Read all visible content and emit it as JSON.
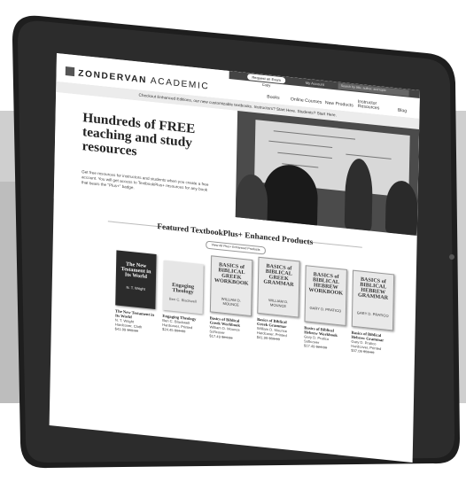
{
  "topbar": {
    "exam_pill": "Request an Exam Copy",
    "account": "My Account",
    "search_placeholder": "Search by title, author, and topic"
  },
  "brand": {
    "logo_bold": "ZONDERVAN",
    "logo_light": "ACADEMIC"
  },
  "nav": {
    "items": [
      "Books",
      "Online Courses",
      "New Products",
      "Instructor Resources",
      "Blog"
    ]
  },
  "banner": {
    "text": "Checkout Enhanced Editions, our new customizable textbooks. Instructors? Start Here. Students? Start Here."
  },
  "hero": {
    "title": "Hundreds of FREE teaching and study resources",
    "body": "Get free resources for instructors and students when you create a free account. You will get access to TextbookPlus+ resources for any book that bears the \"Plus+\" badge."
  },
  "featured": {
    "heading": "Featured TextbookPlus+ Enhanced Products",
    "view_all": "View All Plus+ Enhanced Products"
  },
  "books": [
    {
      "cover": "The New Testament in Its World",
      "cover_sub": "N. T. Wright",
      "title": "The New Testament in Its World",
      "author": "N. T. Wright",
      "format": "Hardcover, Cloth",
      "price": "$41.99",
      "old_price": "$59.99"
    },
    {
      "cover": "Engaging Theology",
      "cover_sub": "Ben C. Blackwell",
      "title": "Engaging Theology",
      "author": "Ben C. Blackwell",
      "format": "Hardcover, Printed",
      "price": "$24.45",
      "old_price": "$34.99"
    },
    {
      "cover": "BASICS of BIBLICAL GREEK WORKBOOK",
      "cover_sub": "WILLIAM D. MOUNCE",
      "title": "Basics of Biblical Greek Workbook",
      "author": "William D. Mounce",
      "format": "Softcover",
      "price": "$17.49",
      "old_price": "$24.99"
    },
    {
      "cover": "BASICS of BIBLICAL GREEK GRAMMAR",
      "cover_sub": "WILLIAM D. MOUNCE",
      "title": "Basics of Biblical Greek Grammar",
      "author": "William D. Mounce",
      "format": "Hardcover, Printed",
      "price": "$41.99",
      "old_price": "$59.99"
    },
    {
      "cover": "BASICS of BIBLICAL HEBREW WORKBOOK",
      "cover_sub": "GARY D. PRATICO",
      "title": "Basics of Biblical Hebrew Workbook",
      "author": "Gary D. Pratico",
      "format": "Softcover",
      "price": "$17.49",
      "old_price": "$24.99"
    },
    {
      "cover": "BASICS of BIBLICAL HEBREW GRAMMAR",
      "cover_sub": "GARY D. PRATICO",
      "title": "Basics of Biblical Hebrew Grammar",
      "author": "Gary D. Pratico",
      "format": "Hardcover, Printed",
      "price": "$37.09",
      "old_price": "$52.99"
    }
  ]
}
